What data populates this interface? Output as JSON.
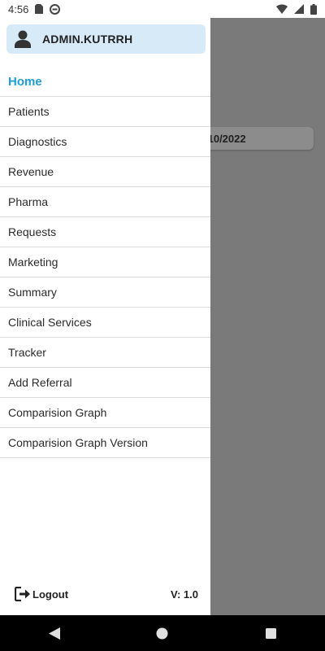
{
  "status_bar": {
    "time": "4:56",
    "icons_left": [
      "sim-card-icon",
      "no-disturb-icon"
    ],
    "icons_right": [
      "wifi-icon",
      "signal-icon",
      "battery-icon"
    ]
  },
  "background": {
    "date_text": "/10/2022"
  },
  "drawer": {
    "user": {
      "name": "ADMIN.KUTRRH",
      "icon": "user-icon"
    },
    "menu": [
      {
        "label": "Home",
        "active": true
      },
      {
        "label": "Patients"
      },
      {
        "label": "Diagnostics"
      },
      {
        "label": "Revenue"
      },
      {
        "label": "Pharma"
      },
      {
        "label": "Requests"
      },
      {
        "label": "Marketing"
      },
      {
        "label": "Summary"
      },
      {
        "label": "Clinical Services"
      },
      {
        "label": "Tracker"
      },
      {
        "label": "Add Referral"
      },
      {
        "label": "Comparision Graph"
      },
      {
        "label": "Comparision Graph Version"
      }
    ],
    "footer": {
      "logout_label": "Logout",
      "version": "V: 1.0"
    }
  },
  "colors": {
    "active": "#1ea0d6",
    "header_bg": "#d6eaf8",
    "scrim": "#7a7a7a"
  },
  "nav_bar": {
    "buttons": [
      "back-icon",
      "home-icon",
      "recents-icon"
    ]
  }
}
